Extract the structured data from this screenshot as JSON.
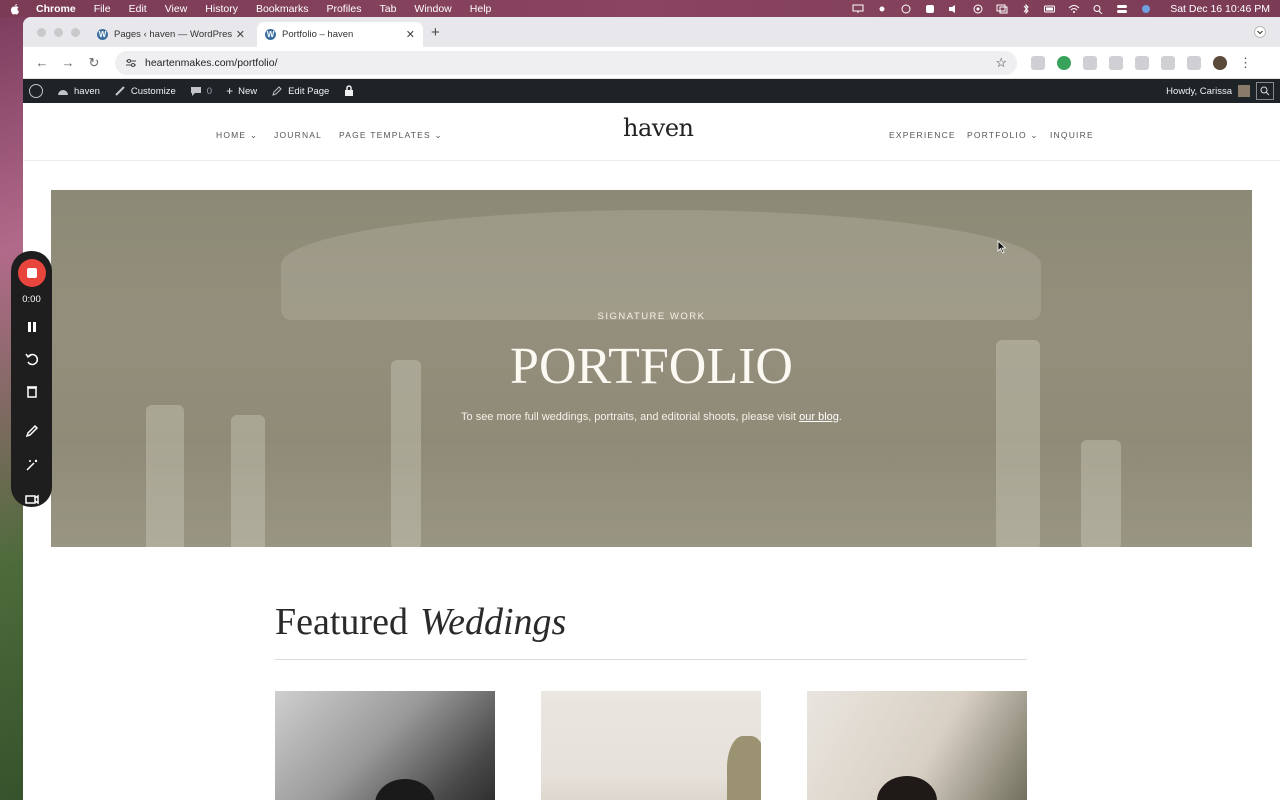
{
  "menubar": {
    "app": "Chrome",
    "items": [
      "File",
      "Edit",
      "View",
      "History",
      "Bookmarks",
      "Profiles",
      "Tab",
      "Window",
      "Help"
    ],
    "clock": "Sat Dec 16  10:46 PM"
  },
  "browser": {
    "tabs": [
      {
        "label": "Pages ‹ haven — WordPress",
        "icon": "wordpress-icon"
      },
      {
        "label": "Portfolio – haven",
        "icon": "wordpress-icon"
      }
    ],
    "url": "heartenmakes.com/portfolio/"
  },
  "adminbar": {
    "site": "haven",
    "customize": "Customize",
    "comments": "0",
    "new": "New",
    "edit": "Edit Page",
    "howdy": "Howdy, Carissa"
  },
  "site": {
    "logo": "haven",
    "nav_left": [
      "HOME ⌄",
      "JOURNAL",
      "PAGE TEMPLATES ⌄"
    ],
    "nav_right": [
      "EXPERIENCE",
      "PORTFOLIO ⌄",
      "INQUIRE"
    ],
    "hero": {
      "eyebrow": "SIGNATURE WORK",
      "title": "PORTFOLIO",
      "subtitle_pre": "To see more full weddings, portraits, and editorial shoots, please visit ",
      "subtitle_link": "our blog",
      "subtitle_post": "."
    },
    "featured": {
      "word1": "Featured",
      "word2": "Weddings"
    }
  },
  "recorder": {
    "time": "0:00"
  }
}
